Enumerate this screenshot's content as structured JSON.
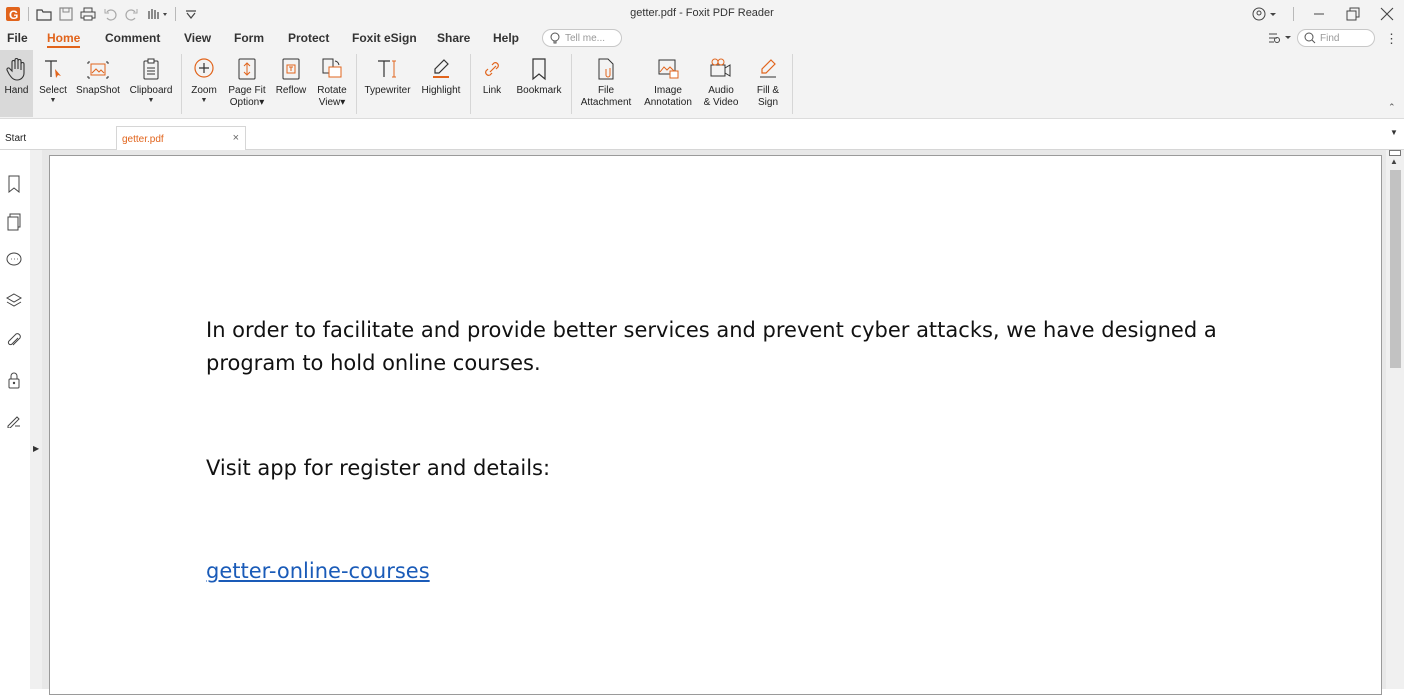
{
  "window": {
    "title": "getter.pdf - Foxit PDF Reader"
  },
  "menu": {
    "items": [
      "File",
      "Home",
      "Comment",
      "View",
      "Form",
      "Protect",
      "Foxit eSign",
      "Share",
      "Help"
    ],
    "tell_me_placeholder": "Tell me...",
    "find_placeholder": "Find"
  },
  "ribbon": {
    "hand": "Hand",
    "select": "Select",
    "snapshot": "SnapShot",
    "clipboard": "Clipboard",
    "zoom": "Zoom",
    "pagefit": "Page Fit\nOption▾",
    "reflow": "Reflow",
    "rotate": "Rotate\nView▾",
    "typewriter": "Typewriter",
    "highlight": "Highlight",
    "link": "Link",
    "bookmark": "Bookmark",
    "file_attachment": "File\nAttachment",
    "image_annotation": "Image\nAnnotation",
    "audio_video": "Audio\n& Video",
    "fill_sign": "Fill &\nSign"
  },
  "tabs": {
    "start": "Start",
    "doc": "getter.pdf"
  },
  "document": {
    "para1_line1": "In order to facilitate and provide better services and prevent cyber attacks, we have designed a",
    "para1_line2": "program to hold online courses.",
    "para2": "Visit app for register and details:",
    "link": "getter-online-courses"
  },
  "colors": {
    "accent": "#e1641c",
    "link": "#1a5bb8"
  },
  "icons": [
    "foxit-logo-icon",
    "open-icon",
    "save-icon",
    "print-icon",
    "undo-icon",
    "redo-icon",
    "hand-tool-icon",
    "customize-icon",
    "account-icon",
    "minimize-icon",
    "restore-icon",
    "close-icon",
    "search-icon",
    "bookmark-panel-icon",
    "pages-panel-icon",
    "comments-panel-icon",
    "layers-panel-icon",
    "attachments-panel-icon",
    "security-panel-icon",
    "signature-panel-icon"
  ]
}
